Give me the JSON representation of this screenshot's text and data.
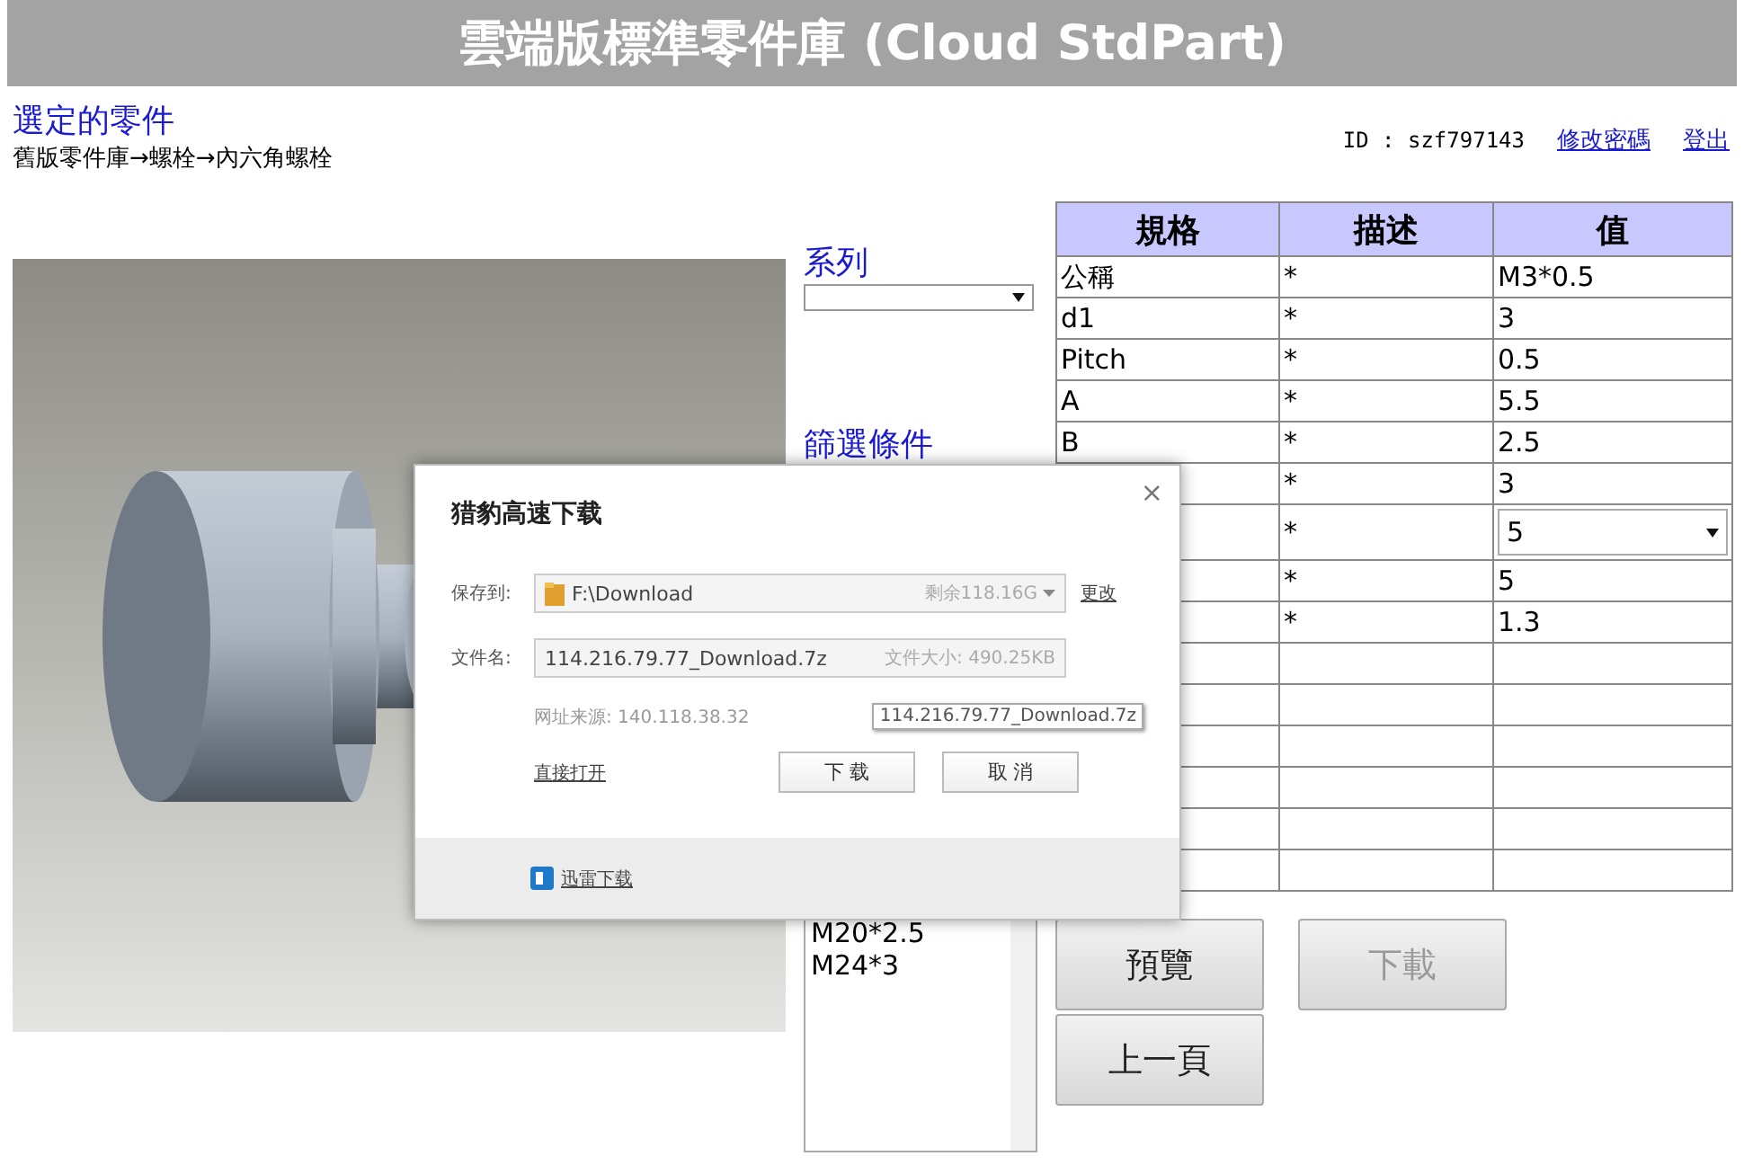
{
  "header": {
    "title": "雲端版標準零件庫 (Cloud StdPart)"
  },
  "selected_part": {
    "title": "選定的零件",
    "breadcrumb": "舊版零件庫→螺栓→內六角螺栓"
  },
  "user": {
    "id_text": "ID : szf797143",
    "links": [
      "修改密碼",
      "登出"
    ]
  },
  "series": {
    "label": "系列"
  },
  "filter": {
    "label": "篩選條件",
    "items": [
      "M20*2.5",
      "M24*3"
    ]
  },
  "table": {
    "columns": [
      "規格",
      "描述",
      "值"
    ],
    "rows": [
      {
        "spec": "公稱",
        "desc": "*",
        "value": "M3*0.5",
        "kind": "text"
      },
      {
        "spec": "d1",
        "desc": "*",
        "value": "3",
        "kind": "text"
      },
      {
        "spec": "Pitch",
        "desc": "*",
        "value": "0.5",
        "kind": "text"
      },
      {
        "spec": "A",
        "desc": "*",
        "value": "5.5",
        "kind": "text"
      },
      {
        "spec": "B",
        "desc": "*",
        "value": "2.5",
        "kind": "text"
      },
      {
        "desc": "*",
        "value": "3",
        "kind": "text"
      },
      {
        "desc": "*",
        "value": "5",
        "kind": "select"
      },
      {
        "desc": "*",
        "value": "5",
        "kind": "text"
      },
      {
        "desc": "*",
        "value": "1.3",
        "kind": "text"
      },
      {
        "kind": "text"
      },
      {
        "kind": "text"
      },
      {
        "kind": "text"
      },
      {
        "kind": "text"
      },
      {
        "kind": "text"
      },
      {
        "kind": "text"
      }
    ]
  },
  "buttons": [
    {
      "label": "預覽",
      "disabled": false
    },
    {
      "label": "下載",
      "disabled": true
    },
    {
      "label": "上一頁",
      "disabled": false
    }
  ],
  "dialog": {
    "title": "猎豹高速下载",
    "close": "×",
    "save_label": "保存到:",
    "save_path": "F:\\Download",
    "free_space": "剩余118.16G",
    "change_link": "更改",
    "name_label": "文件名:",
    "file_name": "114.216.79.77_Download.7z",
    "file_size": "文件大小: 490.25KB",
    "source": "网址来源: 140.118.38.32",
    "tooltip": "114.216.79.77_Download.7z",
    "open_link": "直接打开",
    "download_button": "下 载",
    "cancel_button": "取 消",
    "footer_link": "迅雷下载"
  }
}
